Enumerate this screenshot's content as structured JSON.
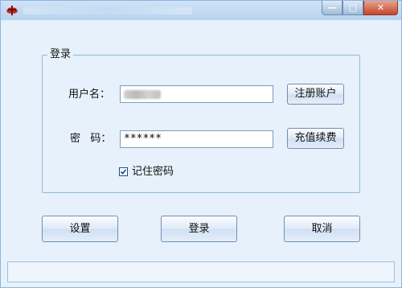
{
  "window": {
    "title": "",
    "controls": {
      "minimize": "—",
      "maximize": "□",
      "close": "✕"
    }
  },
  "login_group": {
    "legend": "登录",
    "username_label": "用户名：",
    "username_value": "",
    "password_label": "密   码：",
    "password_value": "******",
    "register_button": "注册账户",
    "recharge_button": "充值续费",
    "remember_label": "记住密码",
    "remember_checked": true
  },
  "actions": {
    "settings": "设置",
    "login": "登录",
    "cancel": "取消"
  },
  "colors": {
    "accent": "#1c5180",
    "background": "#e6f1fb"
  }
}
